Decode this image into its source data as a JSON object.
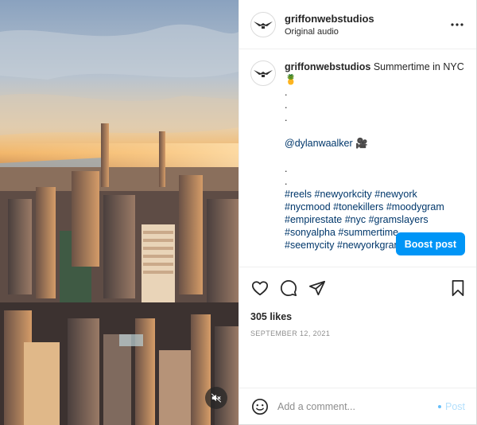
{
  "header": {
    "username": "griffonwebstudios",
    "audio": "Original audio",
    "avatar_icon": "griffon-logo-icon",
    "more_icon": "more-options-icon"
  },
  "caption": {
    "username": "griffonwebstudios",
    "text_first": "Summertime in NYC 🍍",
    "dot_lines": [
      ".",
      ".",
      "."
    ],
    "mention": "@dylanwaalker 🎥",
    "dot_lines_2": [
      ".",
      "."
    ],
    "hashtags": [
      "#reels #newyorkcity #newyork",
      "#nycmood #tonekillers #moodygram",
      "#empirestate #nyc #gramslayers",
      "#sonyalpha #summertime",
      "#seemycity #newyorkgram"
    ]
  },
  "boost_label": "Boost post",
  "actions": {
    "like_icon": "heart-icon",
    "comment_icon": "comment-icon",
    "share_icon": "share-icon",
    "save_icon": "bookmark-icon"
  },
  "likes": "305 likes",
  "date": "SEPTEMBER 12, 2021",
  "comment": {
    "placeholder": "Add a comment...",
    "post_label": "Post",
    "emoji_icon": "emoji-icon"
  },
  "media": {
    "mute_icon": "muted-speaker-icon"
  },
  "colors": {
    "accent": "#0095f6",
    "link": "#00376b",
    "muted": "#8e8e8e"
  }
}
